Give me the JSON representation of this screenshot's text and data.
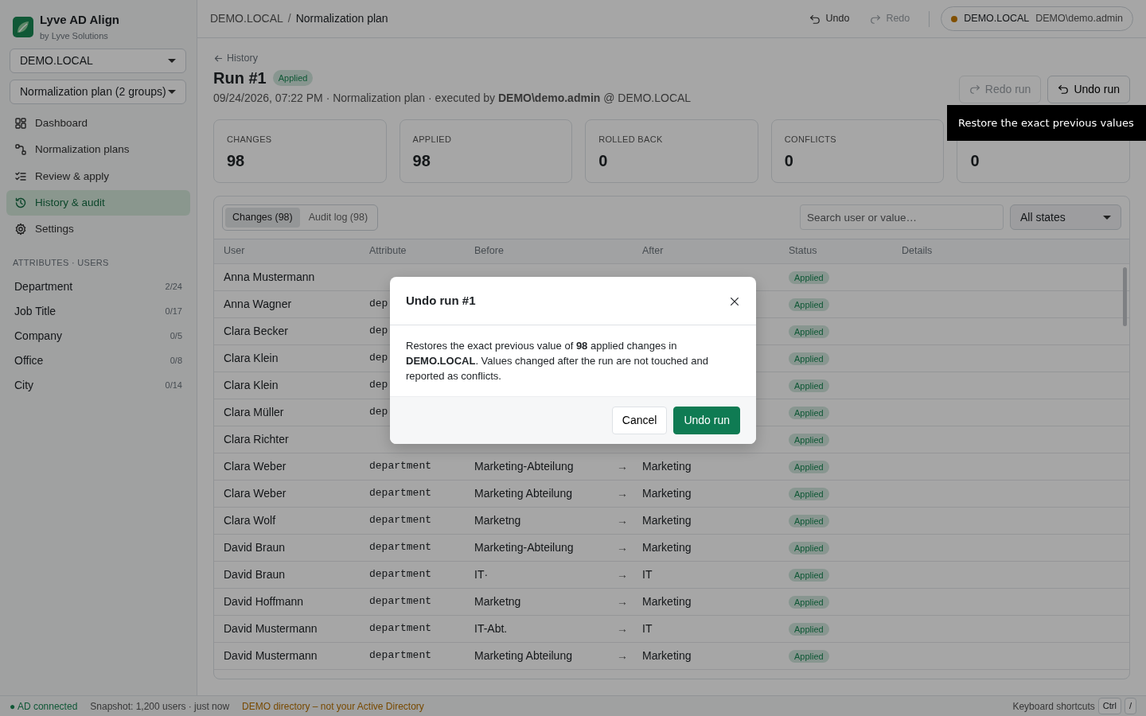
{
  "app": {
    "name": "Lyve AD Align",
    "subtitle": "by Lyve Solutions"
  },
  "domain_select": {
    "value": "DEMO.LOCAL"
  },
  "plan_select": {
    "value": "Normalization plan (2 groups)"
  },
  "nav": [
    {
      "label": "Dashboard",
      "selected": false
    },
    {
      "label": "Normalization plans",
      "selected": false
    },
    {
      "label": "Review & apply",
      "selected": false
    },
    {
      "label": "History & audit",
      "selected": true
    },
    {
      "label": "Settings",
      "selected": false
    }
  ],
  "attributes_section": {
    "title": "ATTRIBUTES · USERS",
    "items": [
      {
        "label": "Department",
        "count": "2/24"
      },
      {
        "label": "Job Title",
        "count": "0/17"
      },
      {
        "label": "Company",
        "count": "0/5"
      },
      {
        "label": "Office",
        "count": "0/8"
      },
      {
        "label": "City",
        "count": "0/14"
      }
    ]
  },
  "breadcrumb": {
    "parent": "DEMO.LOCAL",
    "separator": "/",
    "current": "Normalization plan"
  },
  "toolbar": [
    {
      "label": "Undo",
      "kind": "undo",
      "disabled": false
    },
    {
      "label": "Redo",
      "kind": "redo",
      "disabled": true
    }
  ],
  "connection": {
    "domain": "DEMO.LOCAL",
    "user": "DEMO\\demo.admin"
  },
  "back_link": "History",
  "run": {
    "title": "Run #1",
    "badge": "Applied",
    "meta": "09/24/2026, 07:22 PM · Normalization plan · executed by **DEMO\\demo.admin** @ DEMO.LOCAL"
  },
  "run_actions": [
    {
      "label": "Redo run",
      "kind": "redo",
      "disabled": true
    },
    {
      "label": "Undo run",
      "kind": "undo",
      "disabled": false
    }
  ],
  "stats": [
    {
      "label": "CHANGES",
      "value": "98"
    },
    {
      "label": "APPLIED",
      "value": "98"
    },
    {
      "label": "ROLLED BACK",
      "value": "0"
    },
    {
      "label": "CONFLICTS",
      "value": "0"
    },
    {
      "value": "0"
    }
  ],
  "tabs": [
    {
      "label": "Changes (98)",
      "selected": true
    },
    {
      "label": "Audit log (98)",
      "selected": false
    }
  ],
  "search": {
    "placeholder": "Search user or value…"
  },
  "state_filter": {
    "value": "All states"
  },
  "table": {
    "columns": [
      "User",
      "Attribute",
      "Before",
      "After",
      "Status",
      "Details"
    ],
    "rows": [
      {
        "user": "Anna Mustermann",
        "status": "Applied"
      },
      {
        "user": "Anna Wagner",
        "attribute": "dep",
        "status": "Applied"
      },
      {
        "user": "Clara Becker",
        "attribute": "dep",
        "status": "Applied"
      },
      {
        "user": "Clara Klein",
        "attribute": "dep",
        "status": "Applied"
      },
      {
        "user": "Clara Klein",
        "attribute": "dep",
        "status": "Applied"
      },
      {
        "user": "Clara Müller",
        "attribute": "dep",
        "status": "Applied"
      },
      {
        "user": "Clara Richter",
        "status": "Applied"
      },
      {
        "user": "Clara Weber",
        "attribute": "department",
        "before": "Marketing-Abteilung",
        "arrow": "→",
        "after": "Marketing",
        "status": "Applied"
      },
      {
        "user": "Clara Weber",
        "attribute": "department",
        "before": "Marketing Abteilung",
        "arrow": "→",
        "after": "Marketing",
        "status": "Applied"
      },
      {
        "user": "Clara Wolf",
        "attribute": "department",
        "before": "Marketng",
        "arrow": "→",
        "after": "Marketing",
        "status": "Applied"
      },
      {
        "user": "David Braun",
        "attribute": "department",
        "before": "Marketing-Abteilung",
        "arrow": "→",
        "after": "Marketing",
        "status": "Applied"
      },
      {
        "user": "David Braun",
        "attribute": "department",
        "before": "IT·",
        "arrow": "→",
        "after": "IT",
        "status": "Applied"
      },
      {
        "user": "David Hoffmann",
        "attribute": "department",
        "before": "Marketng",
        "arrow": "→",
        "after": "Marketing",
        "status": "Applied"
      },
      {
        "user": "David Mustermann",
        "attribute": "department",
        "before": "IT-Abt.",
        "arrow": "→",
        "after": "IT",
        "status": "Applied"
      },
      {
        "user": "David Mustermann",
        "attribute": "department",
        "before": "Marketing Abteilung",
        "arrow": "→",
        "after": "Marketing",
        "status": "Applied"
      }
    ]
  },
  "tooltip": "Restore the exact previous values",
  "modal": {
    "title": "Undo run #1",
    "body": "Restores the exact previous value of **98** applied changes in **DEMO.LOCAL**. Values changed after the run are not touched and reported as conflicts.",
    "buttons": [
      {
        "label": "Cancel",
        "kind": "secondary"
      },
      {
        "label": "Undo run",
        "kind": "primary"
      }
    ]
  },
  "status_bar": {
    "connection": "● AD connected",
    "snapshot": "Snapshot: 1,200 users · just now",
    "demo_notice": "DEMO directory – not your Active Directory",
    "shortcuts_label": "Keyboard shortcuts",
    "keys": [
      "Ctrl",
      "/"
    ]
  }
}
